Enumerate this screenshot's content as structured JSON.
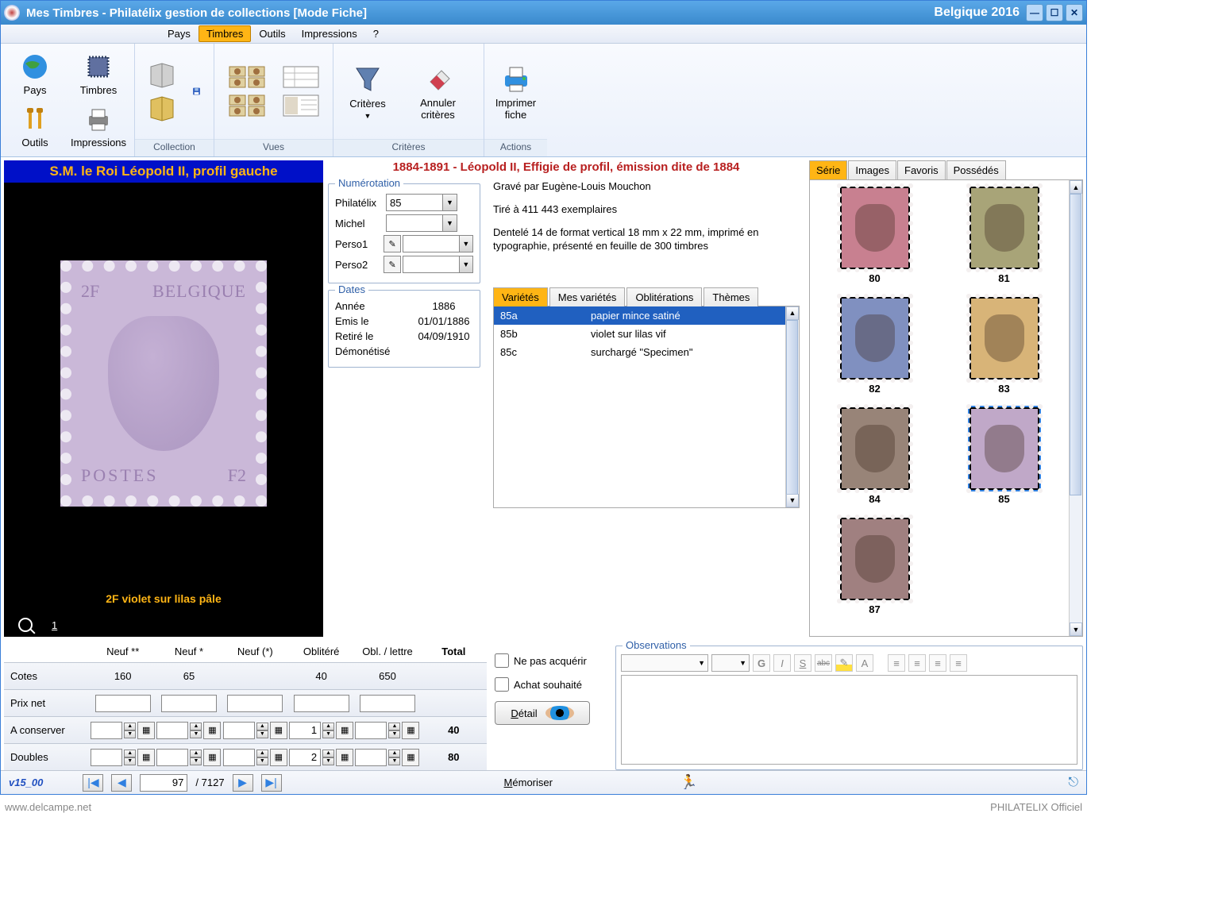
{
  "titlebar": {
    "title": "Mes Timbres - Philatélix gestion de collections [Mode Fiche]",
    "edition": "Belgique 2016"
  },
  "menubar": {
    "items": [
      "Pays",
      "Timbres",
      "Outils",
      "Impressions",
      "?"
    ],
    "active_index": 1
  },
  "leftnav": {
    "items": [
      "Pays",
      "Timbres",
      "Outils",
      "Impressions"
    ]
  },
  "ribbon": {
    "groups": [
      {
        "label": "Collection",
        "buttons": []
      },
      {
        "label": "Vues",
        "buttons": []
      },
      {
        "label": "Critères",
        "buttons": [
          "Critères",
          "Annuler critères"
        ]
      },
      {
        "label": "Actions",
        "buttons": [
          "Imprimer fiche"
        ]
      }
    ]
  },
  "series_title": "1884-1891 - Léopold II, Effigie de profil, émission dite de 1884",
  "stamp_panel": {
    "title": "S.M. le Roi Léopold II, profil gauche",
    "caption": "2F violet sur lilas pâle",
    "zoom": "1",
    "top_text": "BELGIQUE",
    "bottom_text": "POSTES",
    "denom_left": "2F",
    "denom_right": "F2"
  },
  "numerotation": {
    "legend": "Numérotation",
    "rows": [
      {
        "label": "Philatélix",
        "value": "85"
      },
      {
        "label": "Michel",
        "value": ""
      },
      {
        "label": "Perso1",
        "value": "",
        "pen": true
      },
      {
        "label": "Perso2",
        "value": "",
        "pen": true
      }
    ]
  },
  "description": [
    "Gravé par Eugène-Louis Mouchon",
    "Tiré à 411 443 exemplaires",
    "Dentelé 14 de format vertical 18 mm x 22 mm, imprimé en typographie, présenté en feuille de 300 timbres"
  ],
  "dates": {
    "legend": "Dates",
    "rows": [
      {
        "label": "Année",
        "value": "1886"
      },
      {
        "label": "Emis le",
        "value": "01/01/1886"
      },
      {
        "label": "Retiré le",
        "value": "04/09/1910"
      },
      {
        "label": "Démonétisé",
        "value": ""
      }
    ]
  },
  "vtabs": {
    "items": [
      "Variétés",
      "Mes variétés",
      "Oblitérations",
      "Thèmes"
    ],
    "active_index": 0
  },
  "varietes": [
    {
      "code": "85a",
      "label": "papier mince satiné",
      "selected": true
    },
    {
      "code": "85b",
      "label": "violet sur lilas vif",
      "selected": false
    },
    {
      "code": "85c",
      "label": "surchargé \"Specimen\"",
      "selected": false
    }
  ],
  "rtabs": {
    "items": [
      "Série",
      "Images",
      "Favoris",
      "Possédés"
    ],
    "active_index": 0
  },
  "gallery": [
    {
      "num": "80",
      "color": "#c88090"
    },
    {
      "num": "81",
      "color": "#a8a478"
    },
    {
      "num": "82",
      "color": "#8090c0"
    },
    {
      "num": "83",
      "color": "#d8b478"
    },
    {
      "num": "84",
      "color": "#988478"
    },
    {
      "num": "85",
      "color": "#c0a8c8",
      "selected": true
    },
    {
      "num": "87",
      "color": "#a08080",
      "partial": true
    }
  ],
  "val_table": {
    "headers": [
      "Neuf **",
      "Neuf *",
      "Neuf (*)",
      "Oblitéré",
      "Obl. / lettre",
      "Total"
    ],
    "rows": [
      {
        "label": "Cotes",
        "cells": [
          "160",
          "65",
          "",
          "40",
          "650",
          ""
        ],
        "readonly": true
      },
      {
        "label": "Prix net",
        "cells": [
          "",
          "",
          "",
          "",
          "",
          ""
        ],
        "input": true
      },
      {
        "label": "A conserver",
        "cells": [
          "",
          "",
          "",
          "1",
          "",
          "40"
        ],
        "spinner": true
      },
      {
        "label": "Doubles",
        "cells": [
          "",
          "",
          "",
          "2",
          "",
          "80"
        ],
        "spinner": true
      }
    ]
  },
  "options": {
    "ne_pas_acquerir": "Ne pas acquérir",
    "achat_souhaite": "Achat souhaité",
    "detail": "Détail"
  },
  "observations": {
    "legend": "Observations",
    "format_buttons": [
      "G",
      "I",
      "S",
      "abc",
      "✎",
      "A"
    ],
    "align_buttons": 4
  },
  "statusbar": {
    "version": "v15_00",
    "current": "97",
    "total": "7127",
    "memoriser": "Mémoriser"
  },
  "footer": {
    "left": "www.delcampe.net",
    "right": "PHILATELIX Officiel"
  }
}
